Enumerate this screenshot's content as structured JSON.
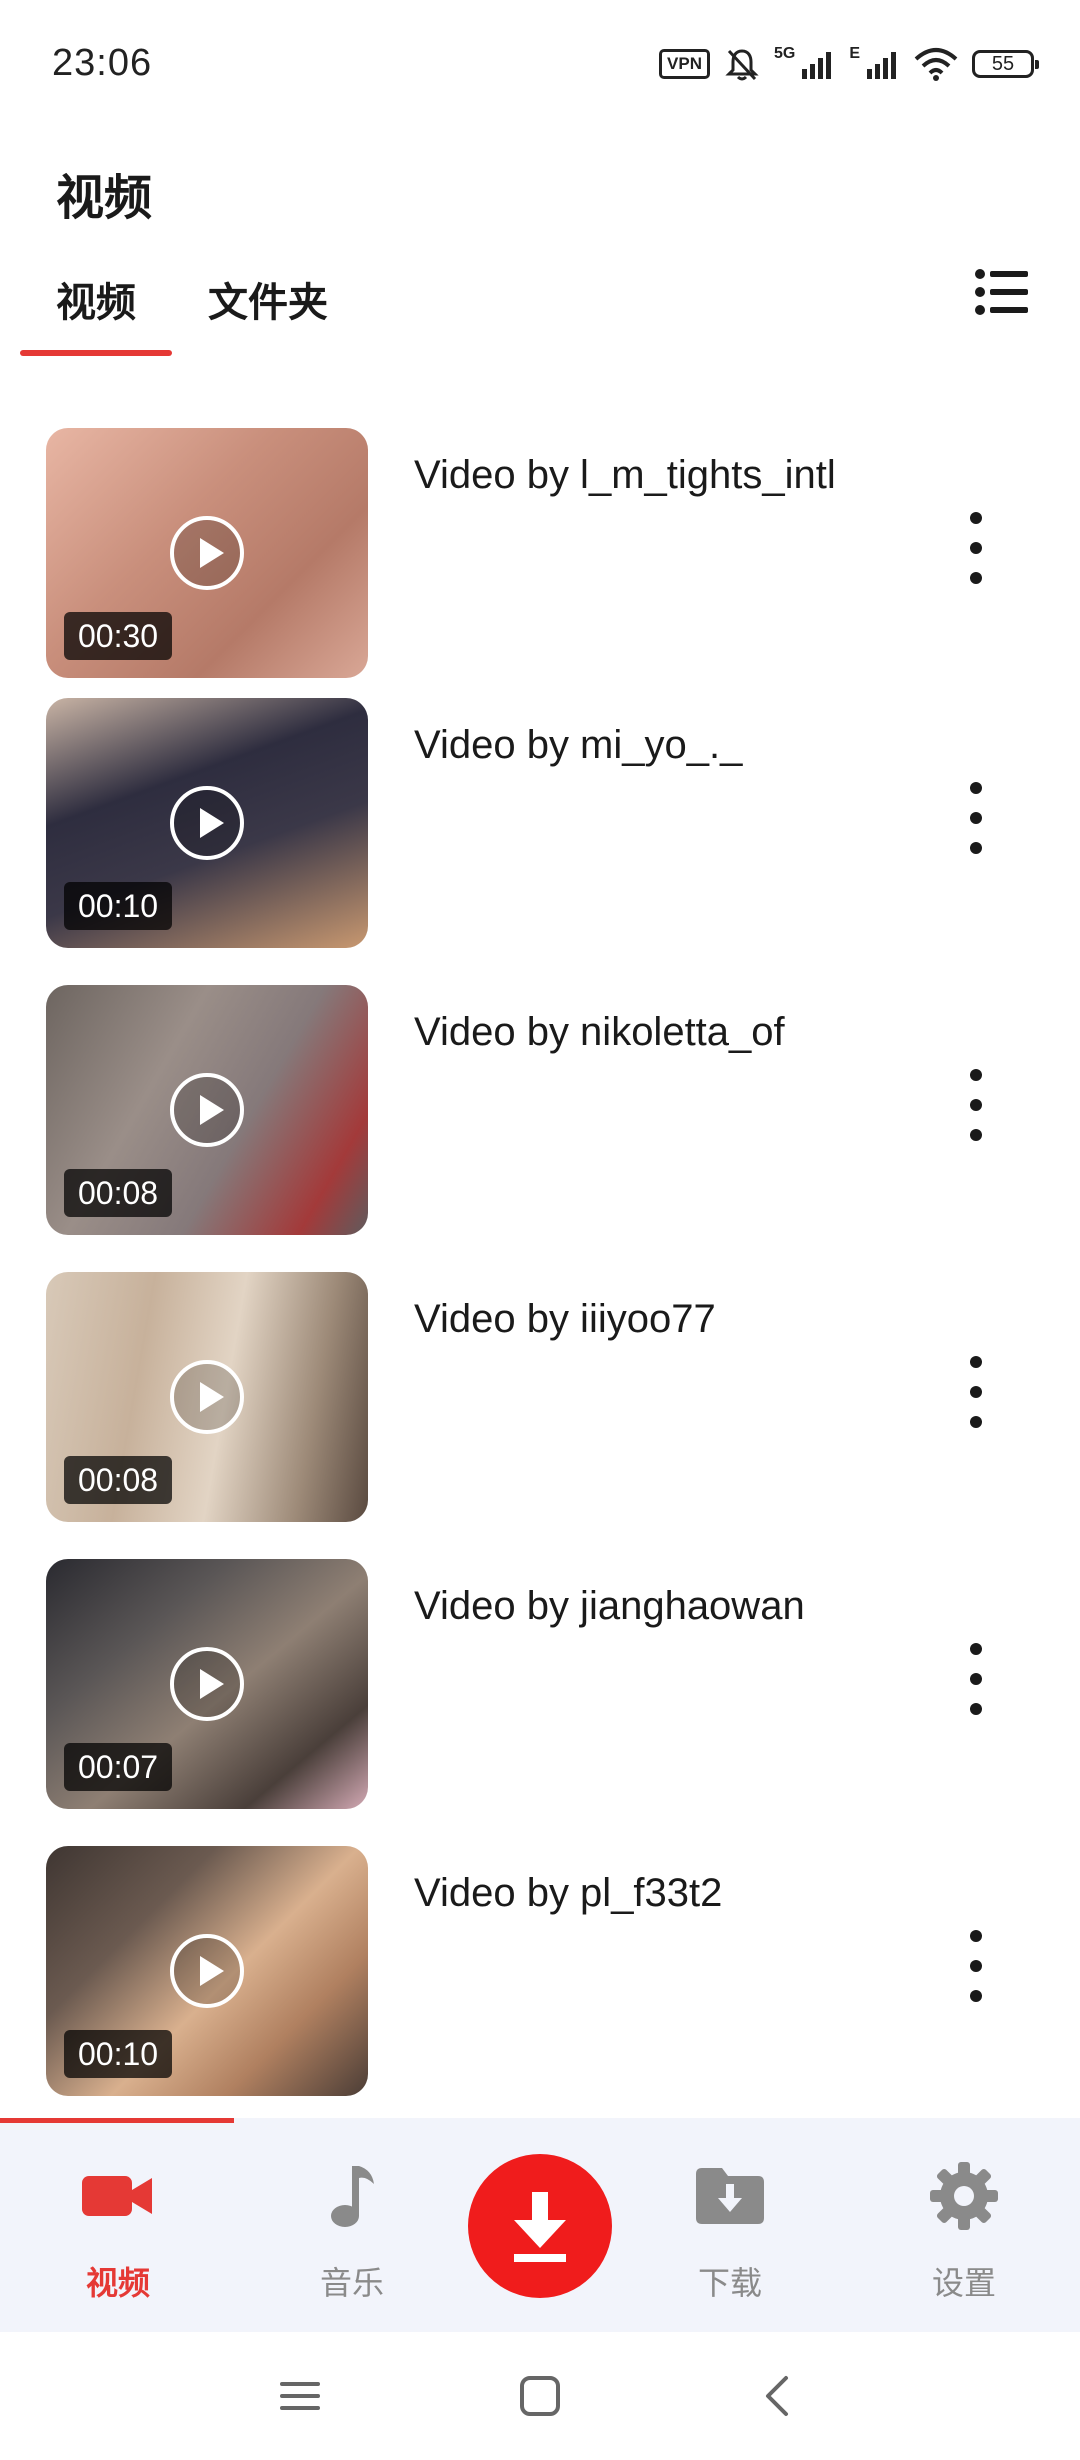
{
  "status_bar": {
    "time": "23:06",
    "vpn": "VPN",
    "network_5g": "5G",
    "network_e": "E",
    "battery": "55"
  },
  "header": {
    "title": "视频",
    "tabs": [
      {
        "label": "视频",
        "active": true
      },
      {
        "label": "文件夹",
        "active": false
      }
    ]
  },
  "videos": [
    {
      "title": "Video by l_m_tights_intl",
      "duration": "00:30"
    },
    {
      "title": "Video by mi_yo_._",
      "duration": "00:10"
    },
    {
      "title": "Video by nikoletta_of",
      "duration": "00:08"
    },
    {
      "title": "Video by iiiyoo77",
      "duration": "00:08"
    },
    {
      "title": "Video by jianghaowan",
      "duration": "00:07"
    },
    {
      "title": "Video by pl_f33t2",
      "duration": "00:10"
    }
  ],
  "bottom_nav": {
    "items": [
      {
        "label": "视频",
        "icon": "video-camera-icon",
        "active": true
      },
      {
        "label": "音乐",
        "icon": "music-note-icon",
        "active": false
      },
      {
        "label": "",
        "icon": "download-icon",
        "active": false
      },
      {
        "label": "下载",
        "icon": "download-folder-icon",
        "active": false
      },
      {
        "label": "设置",
        "icon": "settings-gear-icon",
        "active": false
      }
    ]
  },
  "colors": {
    "accent": "#e53935",
    "fab": "#f01c1c",
    "nav_background": "#f2f4fb",
    "inactive": "#8a8a8a"
  }
}
